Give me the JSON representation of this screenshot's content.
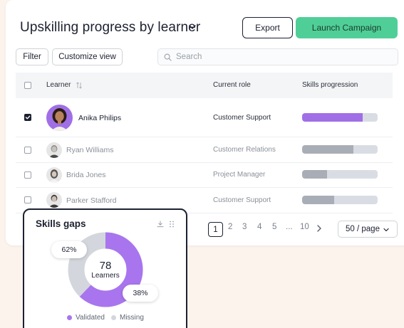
{
  "header": {
    "title": "Upskilling progress by learner",
    "export_label": "Export",
    "launch_label": "Launch Campaign"
  },
  "toolbar": {
    "filter_label": "Filter",
    "customize_label": "Customize view",
    "search_placeholder": "Search"
  },
  "table": {
    "columns": [
      "Learner",
      "Current role",
      "Skills progression"
    ],
    "rows": [
      {
        "name": "Anika Philips",
        "role": "Customer Support",
        "progress": 0.8,
        "selected": true,
        "fill_color": "#a06fe6"
      },
      {
        "name": "Ryan Williams",
        "role": "Customer Relations",
        "progress": 0.68,
        "selected": false,
        "fill_color": "#a9aeb6"
      },
      {
        "name": "Brida Jones",
        "role": "Project Manager",
        "progress": 0.33,
        "selected": false,
        "fill_color": "#a9aeb6"
      },
      {
        "name": "Parker Stafford",
        "role": "Customer Support",
        "progress": 0.42,
        "selected": false,
        "fill_color": "#a9aeb6"
      }
    ]
  },
  "pagination": {
    "current": "1",
    "pages": [
      "2",
      "3",
      "4",
      "5"
    ],
    "ellipsis": "...",
    "last": "10",
    "per_page": "50 / page"
  },
  "skills_gaps": {
    "title": "Skills gaps",
    "center_value": "78",
    "center_label": "Learners",
    "validated_pct": "62%",
    "missing_pct": "38%",
    "legend_validated": "Validated",
    "legend_missing": "Missing",
    "validated_fraction": 0.62,
    "colors": {
      "validated": "#a875ee",
      "missing": "#d3d7dd"
    }
  },
  "colors": {
    "accent_green": "#4fcf97",
    "accent_purple": "#a06fe6",
    "background": "#fbf3ec"
  }
}
